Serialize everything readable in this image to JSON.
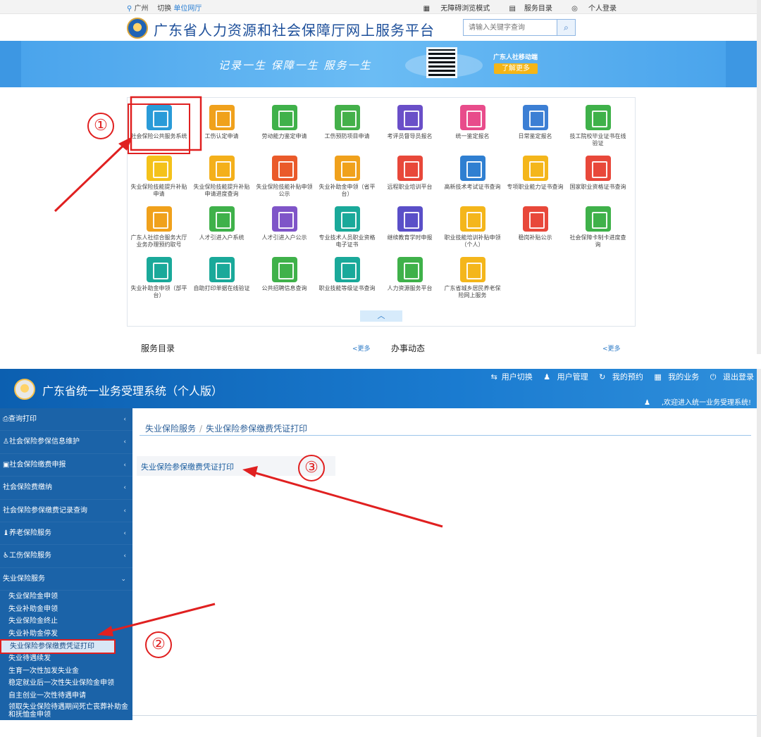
{
  "portal": {
    "location": "广州",
    "switch": "切换",
    "unit_link": "单位网厅",
    "accessible_mode": "无障碍浏览模式",
    "service_directory": "服务目录",
    "login": "个人登录",
    "title": "广东省人力资源和社会保障厅网上服务平台",
    "search_placeholder": "请输入关键字查询",
    "banner_slogan": "记录一生  保障一生  服务一生",
    "banner_app": "广东人社移动端",
    "banner_more": "了解更多",
    "services": [
      {
        "label": "社会保险公共服务系统",
        "color": "#2a9bd8"
      },
      {
        "label": "工伤认定申请",
        "color": "#f0a11c"
      },
      {
        "label": "劳动能力鉴定申请",
        "color": "#3fb14a"
      },
      {
        "label": "工伤预防项目申请",
        "color": "#44b04a"
      },
      {
        "label": "考评员督导员报名",
        "color": "#6a4fc8"
      },
      {
        "label": "统一鉴定报名",
        "color": "#e84c8b"
      },
      {
        "label": "日常鉴定报名",
        "color": "#3c7fd4"
      },
      {
        "label": "技工院校毕业证书在线验证",
        "color": "#3fb14a"
      },
      {
        "label": "失业保险技能提升补贴申请",
        "color": "#f4c21b"
      },
      {
        "label": "失业保险技能提升补贴申请进度查询",
        "color": "#f4b01b"
      },
      {
        "label": "失业保险技能补贴申领公示",
        "color": "#ea5a2a"
      },
      {
        "label": "失业补助金申领（省平台）",
        "color": "#f0a11c"
      },
      {
        "label": "远程职业培训平台",
        "color": "#e8483a"
      },
      {
        "label": "高新技术考试证书查询",
        "color": "#2f7fd1"
      },
      {
        "label": "专项职业能力证书查询",
        "color": "#f4b61b"
      },
      {
        "label": "国家职业资格证书查询",
        "color": "#e8483a"
      },
      {
        "label": "广东人社综合服务大厅业务办理预约取号",
        "color": "#f0a11c"
      },
      {
        "label": "人才引进入户系统",
        "color": "#3fb14a"
      },
      {
        "label": "人才引进入户公示",
        "color": "#7f55c8"
      },
      {
        "label": "专业技术人员职业资格电子证书",
        "color": "#1aa99a"
      },
      {
        "label": "继续教育学时申报",
        "color": "#5a4fc8"
      },
      {
        "label": "职业技能培训补贴申领（个人）",
        "color": "#f4b61b"
      },
      {
        "label": "稳岗补贴公示",
        "color": "#e8483a"
      },
      {
        "label": "社会保障卡制卡进度查询",
        "color": "#3fb14a"
      },
      {
        "label": "失业补助金申领（部平台）",
        "color": "#1aa99a"
      },
      {
        "label": "自助打印单据在线验证",
        "color": "#1aa99a"
      },
      {
        "label": "公共招聘信息查询",
        "color": "#3fb14a"
      },
      {
        "label": "职业技能等级证书查询",
        "color": "#1aa99a"
      },
      {
        "label": "人力资源服务平台",
        "color": "#3fb14a"
      },
      {
        "label": "广东省城乡居民养老保险网上服务",
        "color": "#f4b61b"
      }
    ],
    "service_dir_heading": "服务目录",
    "more1": "<更多",
    "news_heading": "办事动态",
    "more2": "<更多"
  },
  "system": {
    "title": "广东省统一业务受理系统（个人版）",
    "nav": [
      "用户切换",
      "用户管理",
      "我的预约",
      "我的业务",
      "退出登录"
    ],
    "welcome": ",欢迎进入统一业务受理系统!",
    "menu": [
      {
        "label": "查询打印"
      },
      {
        "label": "社会保险参保信息维护"
      },
      {
        "label": "社会保险缴费申报"
      },
      {
        "label": "社会保险费缴纳"
      },
      {
        "label": "社会保险参保缴费记录查询"
      },
      {
        "label": "养老保险服务"
      },
      {
        "label": "工伤保险服务"
      },
      {
        "label": "失业保险服务"
      }
    ],
    "submenu": [
      {
        "label": "失业保险金申领"
      },
      {
        "label": "失业补助金申领"
      },
      {
        "label": "失业保险金终止"
      },
      {
        "label": "失业补助金停发"
      },
      {
        "label": "失业保险参保缴费凭证打印"
      },
      {
        "label": "失业待遇续发"
      },
      {
        "label": "生育一次性加发失业金"
      },
      {
        "label": "稳定就业后一次性失业保险金申领"
      },
      {
        "label": "自主创业一次性待遇申请"
      },
      {
        "label": "领取失业保险待遇期间死亡丧葬补助金和抚恤金申领"
      }
    ],
    "breadcrumb": [
      "失业保险服务",
      "失业保险参保缴费凭证打印"
    ],
    "print_link": "失业保险参保缴费凭证打印"
  },
  "annotations": {
    "step1": "①",
    "step2": "②",
    "step3": "③",
    "color": "#e02020"
  }
}
